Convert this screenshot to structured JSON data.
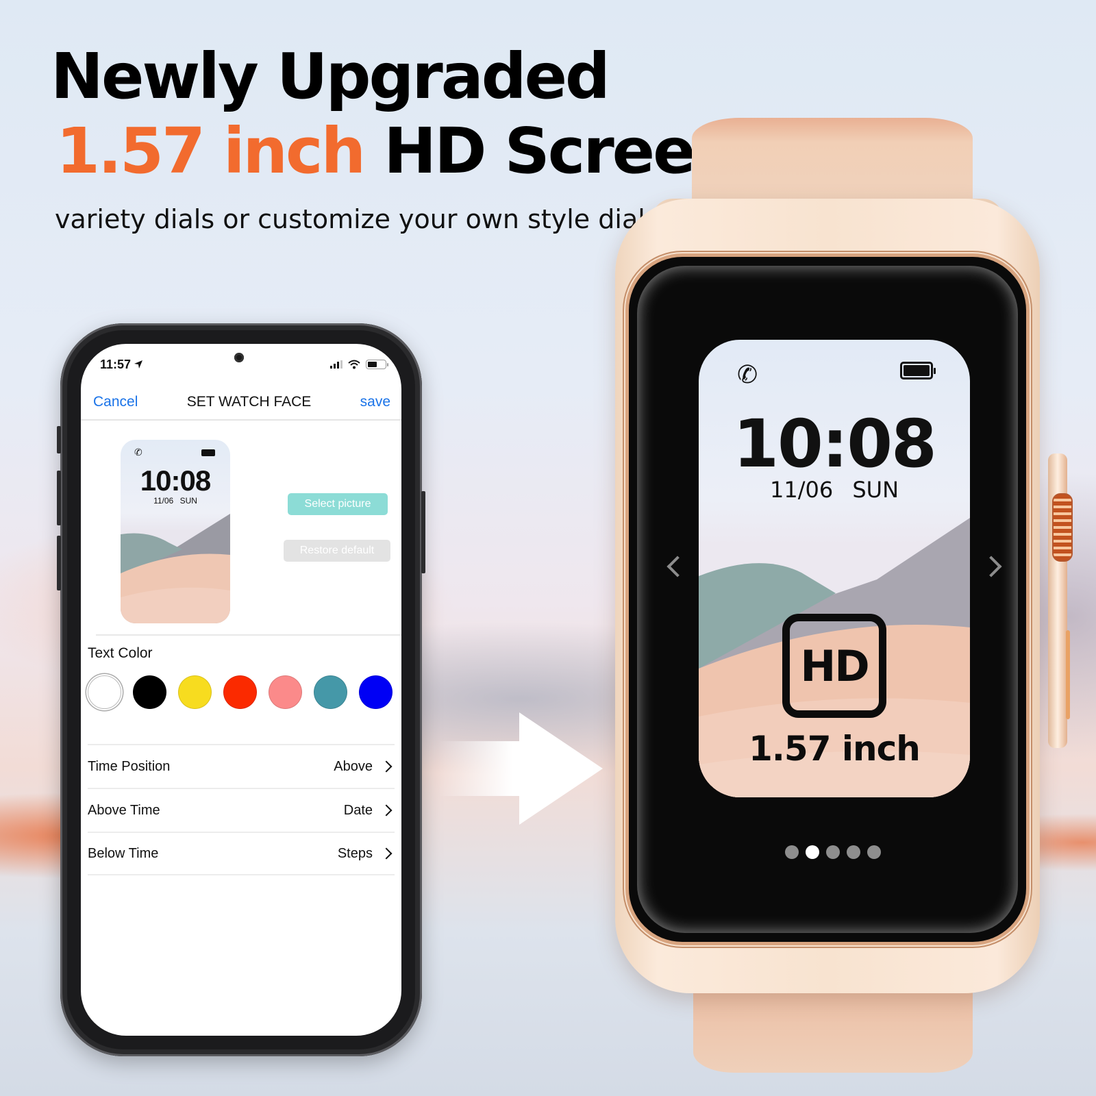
{
  "headline": {
    "line1": "Newly Upgraded",
    "line2_highlight": "1.57 inch",
    "line2_rest": "HD Screen",
    "subline": "variety dials or customize your own style dial.",
    "highlight_color": "#f26b2e"
  },
  "phone": {
    "status_bar": {
      "time": "11:57",
      "location_icon": "location-arrow-icon",
      "signal_icon": "cellular-signal-icon",
      "wifi_icon": "wifi-icon",
      "battery_icon": "battery-icon"
    },
    "navbar": {
      "cancel_label": "Cancel",
      "title": "SET WATCH FACE",
      "save_label": "save",
      "link_color": "#1a73e8"
    },
    "preview": {
      "time": "10:08",
      "date": "11/06",
      "weekday": "SUN",
      "phone_icon": "phone-icon",
      "battery_icon": "battery-icon"
    },
    "buttons": {
      "select_picture": "Select picture",
      "restore_default": "Restore default"
    },
    "text_color": {
      "label": "Text Color",
      "swatches": [
        {
          "name": "white",
          "hex": "#ffffff",
          "selected": true
        },
        {
          "name": "black",
          "hex": "#000000",
          "selected": false
        },
        {
          "name": "yellow",
          "hex": "#f7dc1f",
          "selected": false
        },
        {
          "name": "red",
          "hex": "#fb2a00",
          "selected": false
        },
        {
          "name": "pink",
          "hex": "#fb8a8a",
          "selected": false
        },
        {
          "name": "teal",
          "hex": "#4598a8",
          "selected": false
        },
        {
          "name": "blue",
          "hex": "#0000f5",
          "selected": false
        }
      ]
    },
    "settings": [
      {
        "label": "Time Position",
        "value": "Above"
      },
      {
        "label": "Above Time",
        "value": "Date"
      },
      {
        "label": "Below Time",
        "value": "Steps"
      }
    ]
  },
  "watch": {
    "screen": {
      "time": "10:08",
      "date": "11/06",
      "weekday": "SUN",
      "hd_badge": "HD",
      "size_label": "1.57 inch",
      "phone_icon": "phone-icon",
      "battery_icon": "battery-icon"
    },
    "pager": {
      "total": 5,
      "active_index": 1
    }
  }
}
